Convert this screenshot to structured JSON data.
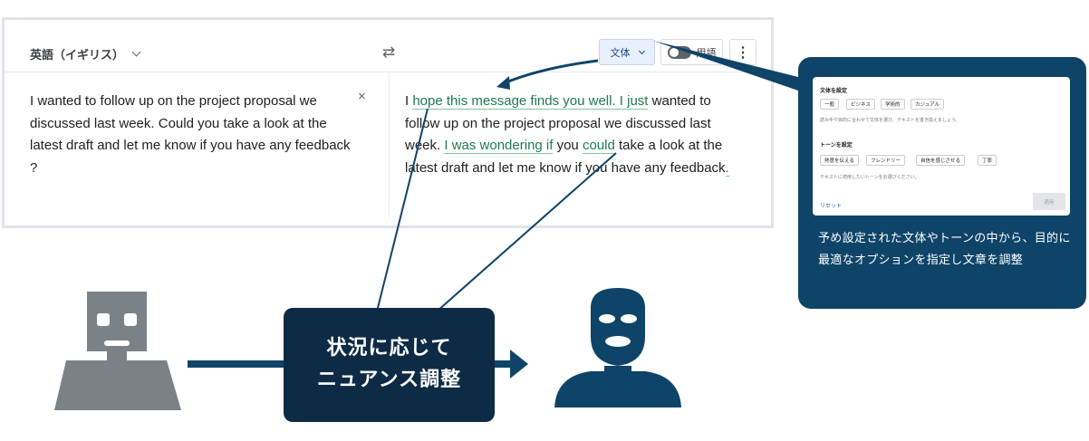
{
  "translator": {
    "source_language": "英語（イギリス）",
    "swap_icon": "⇄",
    "style_button_label": "文体",
    "glossary_label": "用語",
    "more_icon": "⋮",
    "clear_icon": "×",
    "source_text": "I wanted to follow up on the project proposal we discussed last week. Could you take a look at the latest draft and let me know if you have any feedback ?",
    "target_segments": [
      {
        "text": "I ",
        "highlight": false
      },
      {
        "text": "hope this message finds you well. I just",
        "highlight": true
      },
      {
        "text": " wanted to follow up on the project proposal we discussed last week. ",
        "highlight": false
      },
      {
        "text": "I was wondering if",
        "highlight": true
      },
      {
        "text": " you ",
        "highlight": false
      },
      {
        "text": "could",
        "highlight": true
      },
      {
        "text": " take a look at the latest draft and let me know if you have any feedback",
        "highlight": false
      },
      {
        "text": ".",
        "highlight": true
      }
    ]
  },
  "style_panel": {
    "style_title": "文体を設定",
    "style_options": [
      "一般",
      "ビジネス",
      "学術的",
      "カジュアル"
    ],
    "style_note": "読み手や目的に合わせて文体を選び、テキストを書き換えましょう。",
    "tone_title": "トーンを設定",
    "tone_options": [
      "熱意を伝える",
      "フレンドリー",
      "自信を感じさせる",
      "丁寧"
    ],
    "tone_note": "テキストに適用したいトーンをお選びください。",
    "reset_label": "リセット",
    "apply_label": "適用"
  },
  "callout": {
    "description": "予め設定された文体やトーンの中から、目的に最適なオプションを指定し文章を調整"
  },
  "flow": {
    "label_line1": "状況に応じて",
    "label_line2": "ニュアンス調整"
  },
  "colors": {
    "navy": "#0e4468",
    "dark_navy": "#0d2b45",
    "robot_gray": "#7a8288",
    "highlight_green": "#1e7a4e"
  }
}
